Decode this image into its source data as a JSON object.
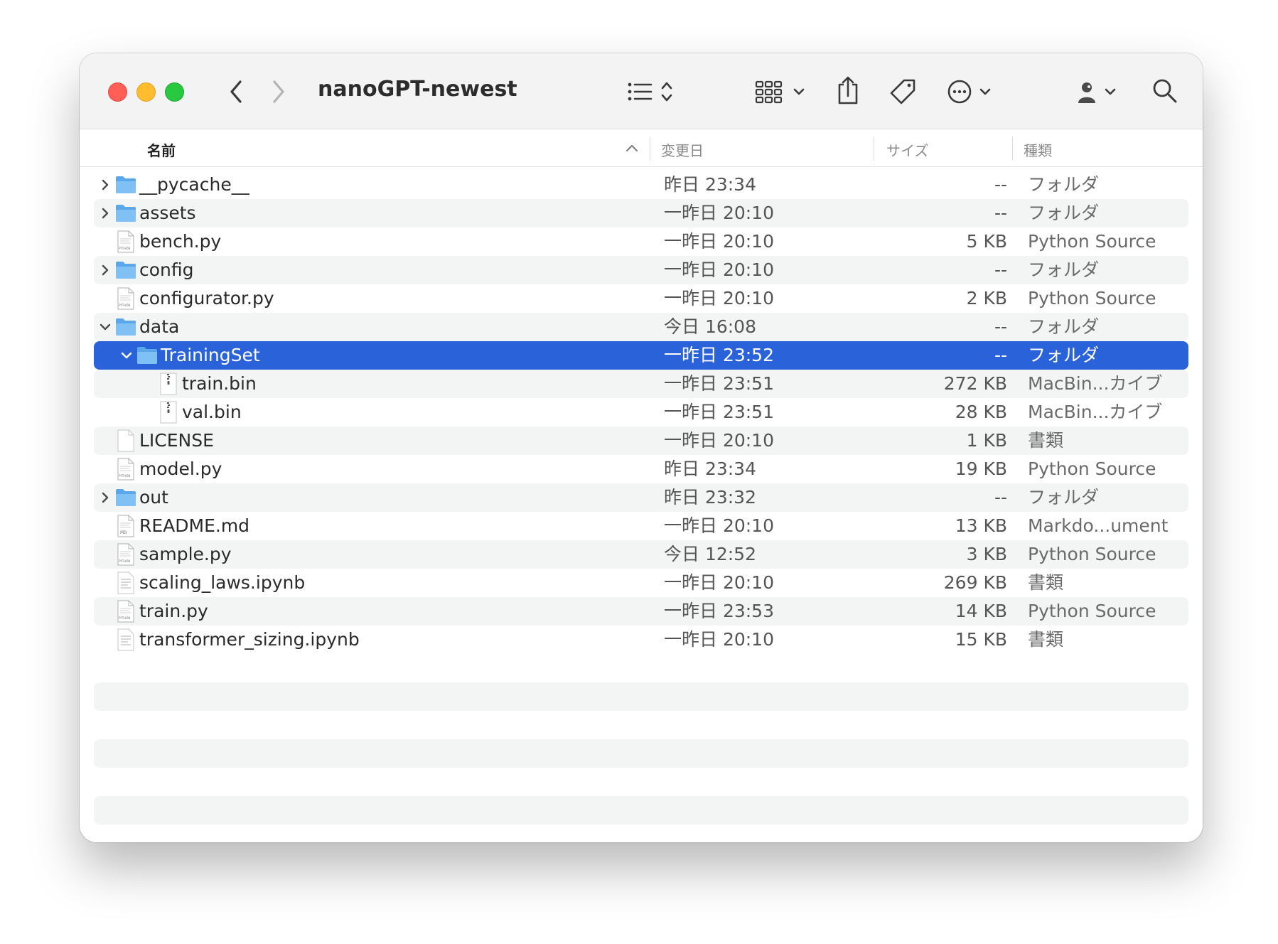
{
  "window": {
    "title": "nanoGPT-newest"
  },
  "columns": {
    "name": "名前",
    "date": "変更日",
    "size": "サイズ",
    "kind": "種類"
  },
  "rows": [
    {
      "name": "__pycache__",
      "date": "昨日 23:34",
      "size": "--",
      "kind": "フォルダ",
      "type": "folder",
      "depth": 0,
      "disclosure": "collapsed",
      "stripe": false
    },
    {
      "name": "assets",
      "date": "一昨日 20:10",
      "size": "--",
      "kind": "フォルダ",
      "type": "folder",
      "depth": 0,
      "disclosure": "collapsed",
      "stripe": true
    },
    {
      "name": "bench.py",
      "date": "一昨日 20:10",
      "size": "5 KB",
      "kind": "Python Source",
      "type": "python",
      "depth": 0,
      "disclosure": "none",
      "stripe": false
    },
    {
      "name": "config",
      "date": "一昨日 20:10",
      "size": "--",
      "kind": "フォルダ",
      "type": "folder",
      "depth": 0,
      "disclosure": "collapsed",
      "stripe": true
    },
    {
      "name": "configurator.py",
      "date": "一昨日 20:10",
      "size": "2 KB",
      "kind": "Python Source",
      "type": "python",
      "depth": 0,
      "disclosure": "none",
      "stripe": false
    },
    {
      "name": "data",
      "date": "今日 16:08",
      "size": "--",
      "kind": "フォルダ",
      "type": "folder",
      "depth": 0,
      "disclosure": "expanded",
      "stripe": true
    },
    {
      "name": "TrainingSet",
      "date": "一昨日 23:52",
      "size": "--",
      "kind": "フォルダ",
      "type": "folder",
      "depth": 1,
      "disclosure": "expanded",
      "stripe": false,
      "selected": true
    },
    {
      "name": "train.bin",
      "date": "一昨日 23:51",
      "size": "272 KB",
      "kind": "MacBin...カイブ",
      "type": "archive",
      "depth": 2,
      "disclosure": "none",
      "stripe": true
    },
    {
      "name": "val.bin",
      "date": "一昨日 23:51",
      "size": "28 KB",
      "kind": "MacBin...カイブ",
      "type": "archive",
      "depth": 2,
      "disclosure": "none",
      "stripe": false
    },
    {
      "name": "LICENSE",
      "date": "一昨日 20:10",
      "size": "1 KB",
      "kind": "書類",
      "type": "blank",
      "depth": 0,
      "disclosure": "none",
      "stripe": true
    },
    {
      "name": "model.py",
      "date": "昨日 23:34",
      "size": "19 KB",
      "kind": "Python Source",
      "type": "python",
      "depth": 0,
      "disclosure": "none",
      "stripe": false
    },
    {
      "name": "out",
      "date": "昨日 23:32",
      "size": "--",
      "kind": "フォルダ",
      "type": "folder",
      "depth": 0,
      "disclosure": "collapsed",
      "stripe": true
    },
    {
      "name": "README.md",
      "date": "一昨日 20:10",
      "size": "13 KB",
      "kind": "Markdo...ument",
      "type": "markdown",
      "depth": 0,
      "disclosure": "none",
      "stripe": false
    },
    {
      "name": "sample.py",
      "date": "今日 12:52",
      "size": "3 KB",
      "kind": "Python Source",
      "type": "python",
      "depth": 0,
      "disclosure": "none",
      "stripe": true
    },
    {
      "name": "scaling_laws.ipynb",
      "date": "一昨日 20:10",
      "size": "269 KB",
      "kind": "書類",
      "type": "text",
      "depth": 0,
      "disclosure": "none",
      "stripe": false
    },
    {
      "name": "train.py",
      "date": "一昨日 23:53",
      "size": "14 KB",
      "kind": "Python Source",
      "type": "python",
      "depth": 0,
      "disclosure": "none",
      "stripe": true
    },
    {
      "name": "transformer_sizing.ipynb",
      "date": "一昨日 20:10",
      "size": "15 KB",
      "kind": "書類",
      "type": "text",
      "depth": 0,
      "disclosure": "none",
      "stripe": false
    }
  ],
  "empty_rows": [
    1,
    3,
    5
  ],
  "colors": {
    "selection": "#2a62d9",
    "folder": "#6cb6f0",
    "stripe": "#f3f4f4"
  },
  "icons": [
    "back-chevron-icon",
    "forward-chevron-icon",
    "list-view-icon",
    "grid-view-icon",
    "share-icon",
    "tag-icon",
    "more-icon",
    "user-icon",
    "search-icon"
  ]
}
